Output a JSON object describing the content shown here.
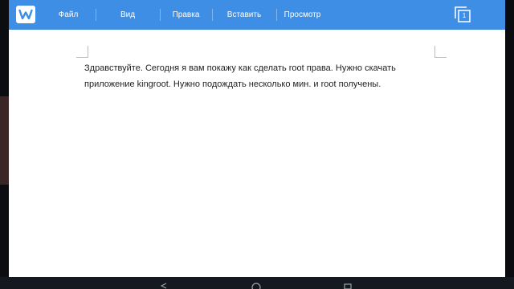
{
  "menu": [
    {
      "label": "Файл"
    },
    {
      "label": "Вид"
    },
    {
      "label": "Правка"
    },
    {
      "label": "Вставить"
    },
    {
      "label": "Просмотр"
    }
  ],
  "pages": {
    "count": "1"
  },
  "document": {
    "text": "Здравствуйте. Сегодня я вам покажу как сделать root права. Нужно скачать приложение kingroot. Нужно подождать несколько мин. и root получены."
  },
  "icons": {
    "logo": "wps-writer-logo-icon",
    "pages": "pages-icon",
    "nav_back": "back-icon",
    "nav_home": "home-icon",
    "nav_recent": "recent-apps-icon"
  },
  "colors": {
    "toolbar": "#3d8ee4",
    "document_background": "#ffffff",
    "text": "#1e1e1e"
  }
}
